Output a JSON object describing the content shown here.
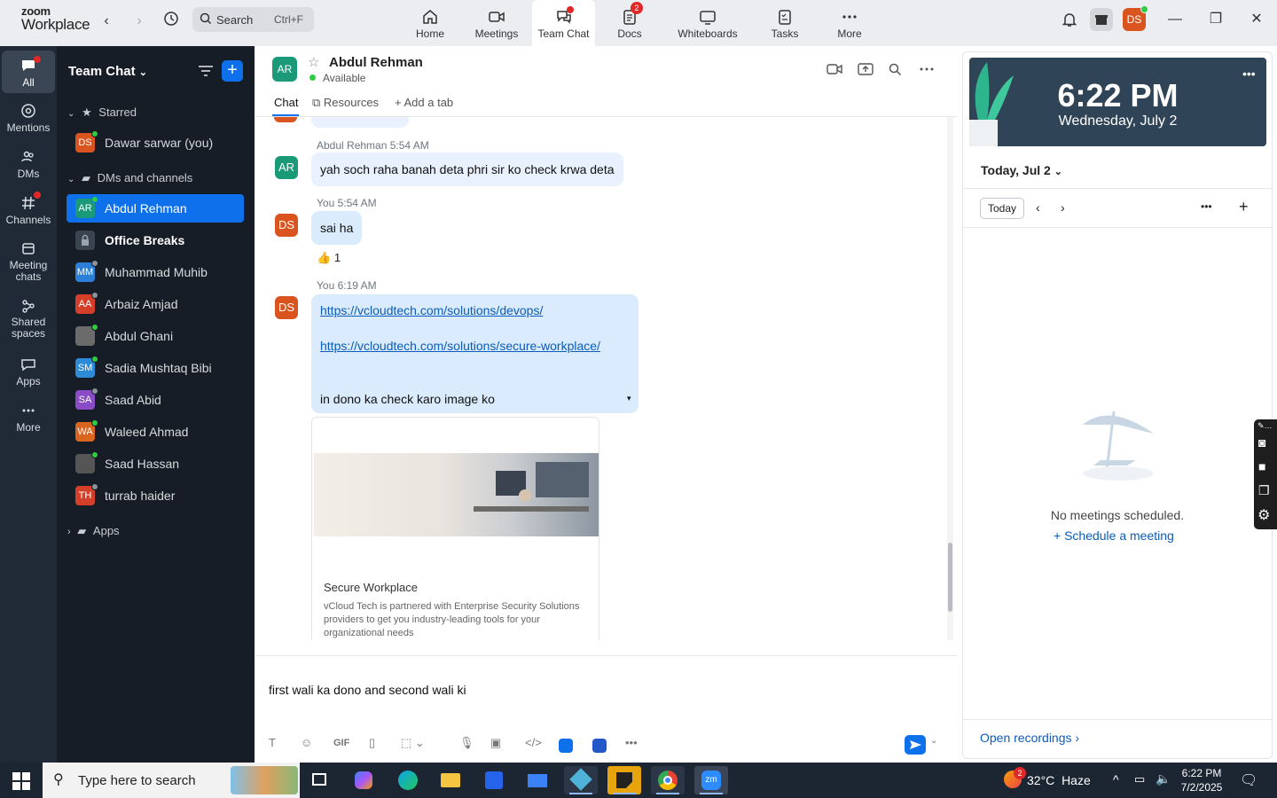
{
  "app": {
    "logo_line1": "zoom",
    "logo_line2": "Workplace"
  },
  "search": {
    "label": "Search",
    "shortcut": "Ctrl+F"
  },
  "topnav": [
    {
      "label": "Home"
    },
    {
      "label": "Meetings"
    },
    {
      "label": "Team Chat"
    },
    {
      "label": "Docs",
      "badge": "2"
    },
    {
      "label": "Whiteboards"
    },
    {
      "label": "Tasks"
    },
    {
      "label": "More"
    }
  ],
  "profile": {
    "initials": "DS"
  },
  "rail": [
    {
      "label": "All"
    },
    {
      "label": "Mentions"
    },
    {
      "label": "DMs"
    },
    {
      "label": "Channels"
    },
    {
      "label": "Meeting chats"
    },
    {
      "label": "Shared spaces"
    },
    {
      "label": "Apps"
    },
    {
      "label": "More"
    }
  ],
  "sidebar": {
    "title": "Team Chat",
    "starred_label": "Starred",
    "starred": [
      {
        "initials": "DS",
        "name": "Dawar sarwar (you)",
        "color": "#d9541e",
        "status": "#2ecc40"
      }
    ],
    "dms_label": "DMs and channels",
    "items": [
      {
        "initials": "AR",
        "name": "Abdul Rehman",
        "color": "#1a9a78",
        "status": "#2ecc40",
        "active": true
      },
      {
        "initials": "",
        "name": "Office Breaks",
        "color": "#3a4450",
        "status": "",
        "bold": true
      },
      {
        "initials": "MM",
        "name": "Muhammad Muhib",
        "color": "#2c7fd6",
        "status": "#8a929c"
      },
      {
        "initials": "AA",
        "name": "Arbaiz Amjad",
        "color": "#d43f2a",
        "status": "#8a929c"
      },
      {
        "initials": "",
        "name": "Abdul Ghani",
        "color": "#6b6b6b",
        "status": "#2ecc40"
      },
      {
        "initials": "SM",
        "name": "Sadia Mushtaq Bibi",
        "color": "#2c8ad6",
        "status": "#2ecc40"
      },
      {
        "initials": "SA",
        "name": "Saad Abid",
        "color": "#8a4bc6",
        "status": "#8a929c"
      },
      {
        "initials": "WA",
        "name": "Waleed Ahmad",
        "color": "#d9651e",
        "status": "#2ecc40"
      },
      {
        "initials": "",
        "name": "Saad Hassan",
        "color": "#555",
        "status": "#2ecc40"
      },
      {
        "initials": "TH",
        "name": "turrab haider",
        "color": "#d43f2a",
        "status": "#8a929c"
      }
    ],
    "apps_label": "Apps"
  },
  "chat": {
    "contact_initials": "AR",
    "contact_name": "Abdul Rehman",
    "contact_status": "Available",
    "tabs": [
      "Chat",
      "Resources",
      "Add a tab"
    ],
    "messages": [
      {
        "sender": "Abdul Rehman",
        "time": "5:54 AM",
        "initials": "AR",
        "text": "yah soch raha banah deta phri sir ko check krwa deta"
      },
      {
        "sender": "You",
        "time": "5:54 AM",
        "initials": "DS",
        "text": "sai ha",
        "reaction": "👍",
        "reaction_count": "1"
      },
      {
        "sender": "You",
        "time": "6:19 AM",
        "initials": "DS",
        "link1": "https://vcloudtech.com/solutions/devops/",
        "link2": "https://vcloudtech.com/solutions/secure-workplace/",
        "text": "in dono ka check karo image ko",
        "preview_title": "Secure Workplace",
        "preview_desc": "vCloud Tech is partnered with Enterprise Security Solutions providers to get you industry-leading tools for your organizational needs"
      }
    ],
    "composer_text": "first wali ka dono and second wali ki"
  },
  "rightpanel": {
    "time": "6:22 PM",
    "date": "Wednesday, July 2",
    "day_label": "Today, Jul 2",
    "today_btn": "Today",
    "empty_text": "No meetings scheduled.",
    "schedule_link": "Schedule a meeting",
    "recordings_link": "Open recordings"
  },
  "taskbar": {
    "search_placeholder": "Type here to search",
    "weather_temp": "32°C",
    "weather_text": "Haze",
    "weather_badge": "2",
    "time": "6:22 PM",
    "date": "7/2/2025"
  }
}
